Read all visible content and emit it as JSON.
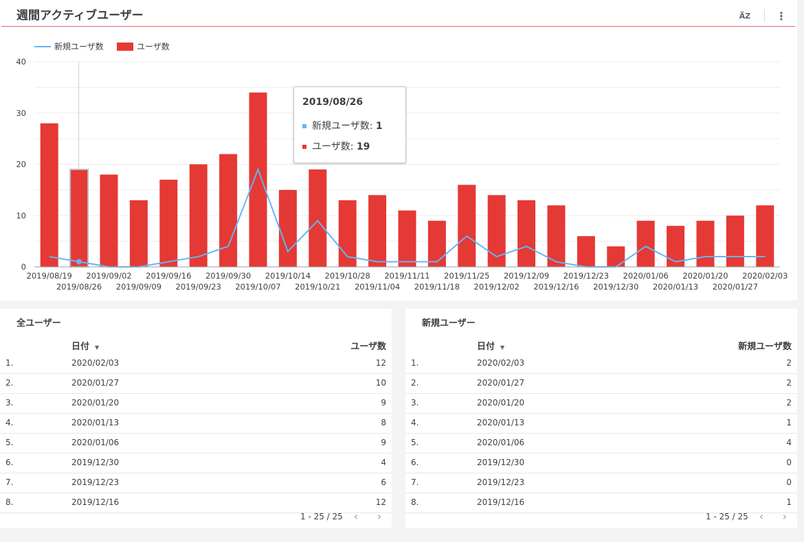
{
  "chart_title": "週間アクティブユーザー",
  "toolbar": {
    "sort_icon": "sort-az-icon",
    "sort_label": "A̅Z",
    "more_icon": "more-vert-icon",
    "more_label": "⋮"
  },
  "colors": {
    "bar": "#e53935",
    "line": "#64b5f6",
    "accent_underline": "#e06666"
  },
  "chart_data": {
    "type": "bar+line",
    "legend_placement": "top-left",
    "legend": [
      "新規ユーザ数",
      "ユーザ数"
    ],
    "ylim": [
      0,
      40
    ],
    "yticks": [
      0,
      10,
      20,
      30,
      40
    ],
    "grid": true,
    "categories": [
      "2019/08/19",
      "2019/08/26",
      "2019/09/02",
      "2019/09/09",
      "2019/09/16",
      "2019/09/23",
      "2019/09/30",
      "2019/10/07",
      "2019/10/14",
      "2019/10/21",
      "2019/10/28",
      "2019/11/04",
      "2019/11/11",
      "2019/11/18",
      "2019/11/25",
      "2019/12/02",
      "2019/12/09",
      "2019/12/16",
      "2019/12/23",
      "2019/12/30",
      "2020/01/06",
      "2020/01/13",
      "2020/01/20",
      "2020/01/27",
      "2020/02/03"
    ],
    "series": [
      {
        "name": "新規ユーザ数",
        "type": "line",
        "values": [
          2,
          1,
          0,
          0,
          1,
          2,
          4,
          19,
          3,
          9,
          2,
          1,
          1,
          1,
          6,
          2,
          4,
          1,
          0,
          0,
          4,
          1,
          2,
          2,
          2
        ]
      },
      {
        "name": "ユーザ数",
        "type": "bar",
        "values": [
          28,
          19,
          18,
          13,
          17,
          20,
          22,
          34,
          15,
          19,
          13,
          14,
          11,
          9,
          16,
          14,
          13,
          12,
          6,
          4,
          9,
          8,
          9,
          10,
          12
        ]
      }
    ],
    "highlight_index": 1
  },
  "tooltip": {
    "date": "2019/08/26",
    "rows": [
      {
        "label": "新規ユーザ数: ",
        "value": "1"
      },
      {
        "label": "ユーザ数: ",
        "value": "19"
      }
    ]
  },
  "all_users_table": {
    "title": "全ユーザー",
    "date_header": "日付",
    "metric_header": "ユーザ数",
    "rows": [
      {
        "n": "1.",
        "date": "2020/02/03",
        "value": "12"
      },
      {
        "n": "2.",
        "date": "2020/01/27",
        "value": "10"
      },
      {
        "n": "3.",
        "date": "2020/01/20",
        "value": "9"
      },
      {
        "n": "4.",
        "date": "2020/01/13",
        "value": "8"
      },
      {
        "n": "5.",
        "date": "2020/01/06",
        "value": "9"
      },
      {
        "n": "6.",
        "date": "2019/12/30",
        "value": "4"
      },
      {
        "n": "7.",
        "date": "2019/12/23",
        "value": "6"
      },
      {
        "n": "8.",
        "date": "2019/12/16",
        "value": "12"
      }
    ],
    "pagination": "1 - 25 / 25"
  },
  "new_users_table": {
    "title": "新規ユーザー",
    "date_header": "日付",
    "metric_header": "新規ユーザ数",
    "rows": [
      {
        "n": "1.",
        "date": "2020/02/03",
        "value": "2"
      },
      {
        "n": "2.",
        "date": "2020/01/27",
        "value": "2"
      },
      {
        "n": "3.",
        "date": "2020/01/20",
        "value": "2"
      },
      {
        "n": "4.",
        "date": "2020/01/13",
        "value": "1"
      },
      {
        "n": "5.",
        "date": "2020/01/06",
        "value": "4"
      },
      {
        "n": "6.",
        "date": "2019/12/30",
        "value": "0"
      },
      {
        "n": "7.",
        "date": "2019/12/23",
        "value": "0"
      },
      {
        "n": "8.",
        "date": "2019/12/16",
        "value": "1"
      }
    ],
    "pagination": "1 - 25 / 25"
  },
  "pager": {
    "prev_icon": "chevron-left-icon",
    "next_icon": "chevron-right-icon",
    "prev_label": "‹",
    "next_label": "›",
    "sort_arrow": "▼"
  }
}
